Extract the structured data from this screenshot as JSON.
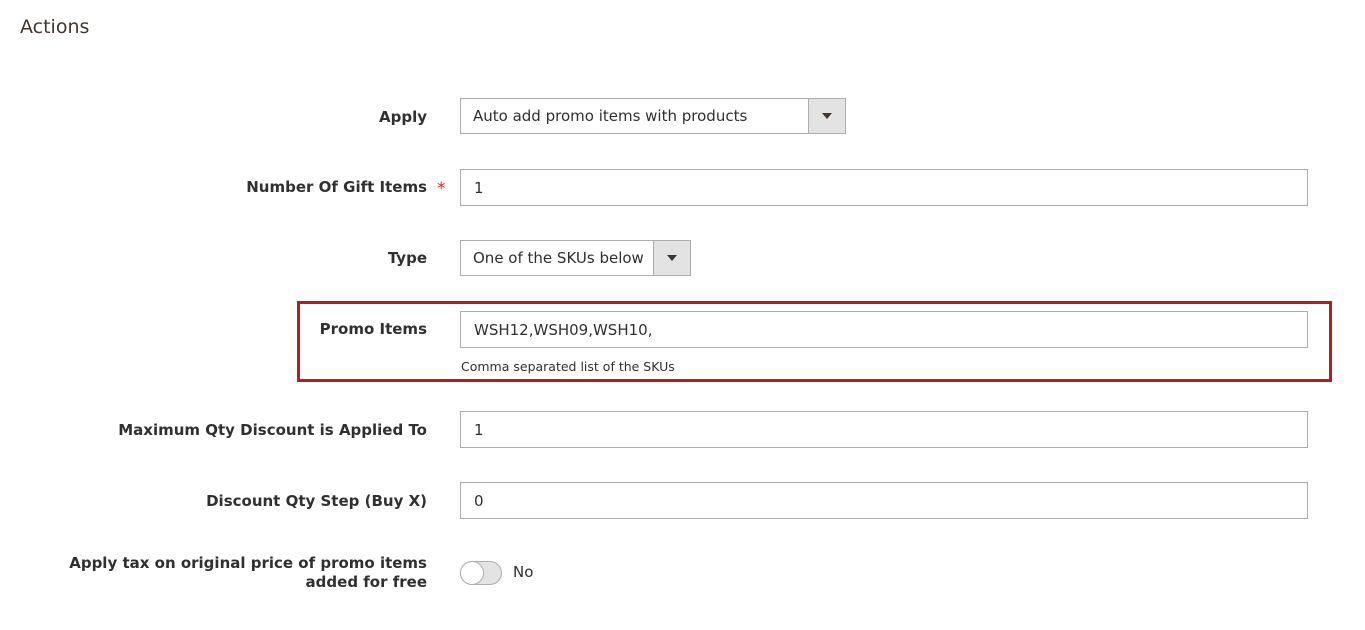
{
  "section": {
    "title": "Actions"
  },
  "fields": {
    "apply": {
      "label": "Apply",
      "value": "Auto add promo items with products"
    },
    "gift_items": {
      "label": "Number Of Gift Items",
      "required_mark": "*",
      "value": "1"
    },
    "type": {
      "label": "Type",
      "value": "One of the SKUs below"
    },
    "promo_items": {
      "label": "Promo Items",
      "value": "WSH12,WSH09,WSH10,",
      "note": "Comma separated list of the SKUs"
    },
    "max_qty": {
      "label": "Maximum Qty Discount is Applied To",
      "value": "1"
    },
    "qty_step": {
      "label": "Discount Qty Step (Buy X)",
      "value": "0"
    },
    "apply_tax": {
      "label": "Apply tax on original price of promo items added for free",
      "toggle_state": "No"
    }
  },
  "colors": {
    "highlight": "#b81c1c",
    "required": "#e22626"
  }
}
